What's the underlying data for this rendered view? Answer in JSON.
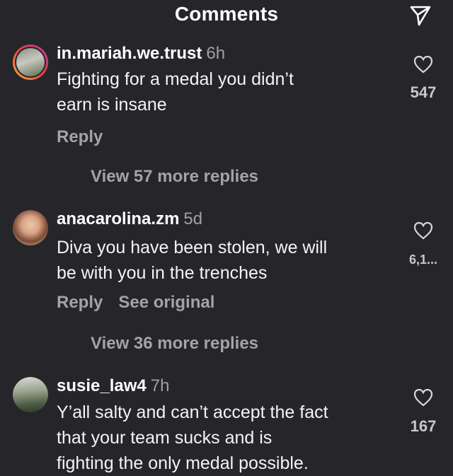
{
  "header": {
    "title": "Comments",
    "share_icon": "send-icon"
  },
  "comments": [
    {
      "username": "in.mariah.we.trust",
      "time": "6h",
      "text_lines": [
        "Fighting for a medal you didn’t",
        "earn is insane"
      ],
      "actions": [
        "Reply"
      ],
      "likes": "547",
      "view_replies": "View 57 more replies"
    },
    {
      "username": "anacarolina.zm",
      "time": "5d",
      "text_lines": [
        "Diva you have been stolen, we will",
        "be with you in the trenches"
      ],
      "actions": [
        "Reply",
        "See original"
      ],
      "likes": "6,1...",
      "view_replies": "View 36 more replies"
    },
    {
      "username": "susie_law4",
      "time": "7h",
      "text_lines": [
        "Y’all salty and can’t accept the fact",
        "that your team sucks and is",
        "fighting the only medal possible."
      ],
      "actions": [],
      "likes": "167",
      "view_replies": ""
    }
  ]
}
